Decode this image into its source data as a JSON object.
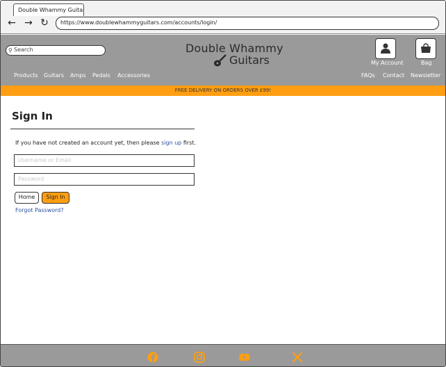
{
  "browser": {
    "tab_title": "Double Whammy Guitars",
    "url": "https://www.doublewhammyguitars.com/accounts/login/",
    "back_icon": "arrow-left-icon",
    "forward_icon": "arrow-right-icon",
    "reload_icon": "reload-icon"
  },
  "header": {
    "search_placeholder": "Search",
    "logo_line1": "Double Whammy",
    "logo_line2": "Guitars",
    "account_label": "My Account",
    "bag_label": "Bag",
    "nav_left": [
      "Products",
      "Guitars",
      "Amps",
      "Pedals",
      "Accessories"
    ],
    "nav_right": [
      "FAQs",
      "Contact",
      "Newsletter"
    ]
  },
  "promo": "FREE DELIVERY ON ORDERS OVER £99!",
  "signin": {
    "title": "Sign In",
    "intro_before": "If you have not created an account yet, then please",
    "intro_link": "sign up",
    "intro_after": "first.",
    "username_placeholder": "Username or Email",
    "password_placeholder": "Password",
    "home_button": "Home",
    "signin_button": "Sign In",
    "forgot_link": "Forgot Password?"
  },
  "footer": {
    "social": [
      "facebook-icon",
      "instagram-icon",
      "youtube-icon",
      "x-icon"
    ]
  },
  "colors": {
    "header_bg": "#9a9a9a",
    "accent": "#ff9e12",
    "link": "#2d4e9e"
  }
}
